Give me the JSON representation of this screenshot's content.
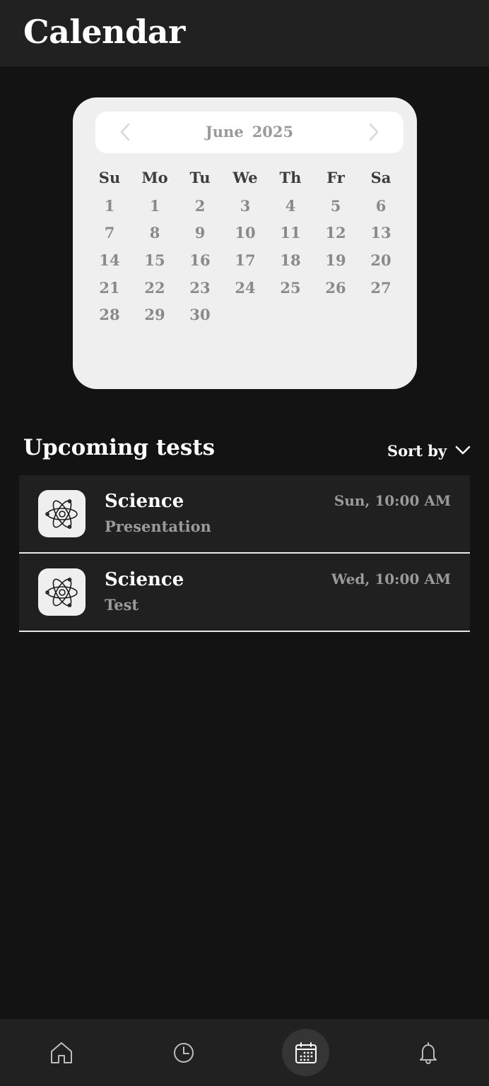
{
  "header": {
    "title": "Calendar"
  },
  "calendar": {
    "month": "June",
    "year": "2025",
    "weekdays": [
      "Su",
      "Mo",
      "Tu",
      "We",
      "Th",
      "Fr",
      "Sa"
    ],
    "weeks": [
      [
        "1",
        "1",
        "2",
        "3",
        "4",
        "5",
        "6"
      ],
      [
        "7",
        "8",
        "9",
        "10",
        "11",
        "12",
        "13"
      ],
      [
        "14",
        "15",
        "16",
        "17",
        "18",
        "19",
        "20"
      ],
      [
        "21",
        "22",
        "23",
        "24",
        "25",
        "26",
        "27"
      ],
      [
        "28",
        "29",
        "30",
        "",
        "",
        "",
        ""
      ]
    ],
    "prev_icon": "chevron-left-icon",
    "next_icon": "chevron-right-icon"
  },
  "upcoming": {
    "title": "Upcoming tests",
    "sort_label": "Sort by",
    "sort_icon": "chevron-down-icon",
    "items": [
      {
        "subject": "Science",
        "kind": "Presentation",
        "when": "Sun, 10:00 AM",
        "icon": "atom-icon"
      },
      {
        "subject": "Science",
        "kind": "Test",
        "when": "Wed, 10:00 AM",
        "icon": "atom-icon"
      }
    ]
  },
  "bottom_nav": {
    "items": [
      {
        "icon": "home-icon",
        "active": false
      },
      {
        "icon": "clock-icon",
        "active": false
      },
      {
        "icon": "calendar-icon",
        "active": true
      },
      {
        "icon": "bell-icon",
        "active": false
      }
    ]
  },
  "colors": {
    "background": "#131313",
    "surface": "#212121",
    "card": "#efefef",
    "muted_text": "#9a9a9a"
  }
}
